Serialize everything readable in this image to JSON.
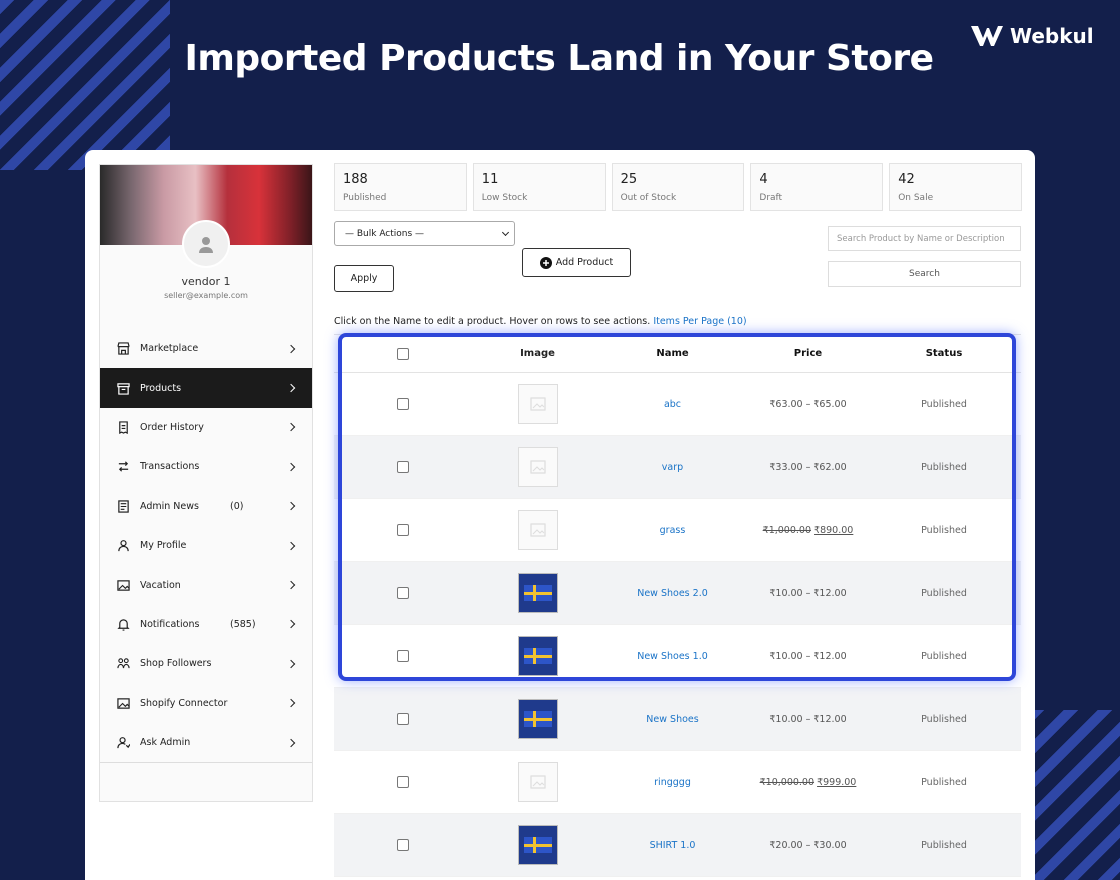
{
  "headline": "Imported Products Land in Your Store",
  "brand": {
    "name": "Webkul"
  },
  "vendor": {
    "name": "vendor 1",
    "email": "seller@example.com"
  },
  "nav": [
    {
      "label": "Marketplace",
      "icon": "store-icon",
      "count": ""
    },
    {
      "label": "Products",
      "icon": "box-icon",
      "count": "",
      "active": true
    },
    {
      "label": "Order History",
      "icon": "receipt-icon",
      "count": ""
    },
    {
      "label": "Transactions",
      "icon": "transfer-icon",
      "count": ""
    },
    {
      "label": "Admin News",
      "icon": "news-icon",
      "count": "(0)"
    },
    {
      "label": "My Profile",
      "icon": "user-icon",
      "count": ""
    },
    {
      "label": "Vacation",
      "icon": "image-icon",
      "count": ""
    },
    {
      "label": "Notifications",
      "icon": "bell-icon",
      "count": "(585)"
    },
    {
      "label": "Shop Followers",
      "icon": "followers-icon",
      "count": ""
    },
    {
      "label": "Shopify Connector",
      "icon": "image-icon",
      "count": ""
    },
    {
      "label": "Ask Admin",
      "icon": "user-question-icon",
      "count": ""
    }
  ],
  "stats": [
    {
      "value": "188",
      "label": "Published"
    },
    {
      "value": "11",
      "label": "Low Stock"
    },
    {
      "value": "25",
      "label": "Out of Stock"
    },
    {
      "value": "4",
      "label": "Draft"
    },
    {
      "value": "42",
      "label": "On Sale"
    }
  ],
  "toolbar": {
    "bulk_actions": "— Bulk Actions —",
    "apply": "Apply",
    "add_product": "Add Product",
    "search_placeholder": "Search Product by Name or Description",
    "search": "Search"
  },
  "hint": {
    "text": "Click on the Name to edit a product. Hover on rows to see actions.",
    "link": "Items Per Page (10)"
  },
  "table": {
    "headers": {
      "image": "Image",
      "name": "Name",
      "price": "Price",
      "status": "Status"
    },
    "rows": [
      {
        "name": "abc",
        "thumb": "placeholder",
        "price_old": "",
        "price": "₹63.00 – ₹65.00",
        "status": "Published"
      },
      {
        "name": "varp",
        "thumb": "placeholder",
        "price_old": "",
        "price": "₹33.00 – ₹62.00",
        "status": "Published"
      },
      {
        "name": "grass",
        "thumb": "placeholder",
        "price_old": "₹1,000.00",
        "price": "₹890.00",
        "status": "Published"
      },
      {
        "name": "New Shoes 2.0",
        "thumb": "photo",
        "price_old": "",
        "price": "₹10.00 – ₹12.00",
        "status": "Published"
      },
      {
        "name": "New Shoes 1.0",
        "thumb": "photo",
        "price_old": "",
        "price": "₹10.00 – ₹12.00",
        "status": "Published"
      },
      {
        "name": "New Shoes",
        "thumb": "photo",
        "price_old": "",
        "price": "₹10.00 – ₹12.00",
        "status": "Published"
      },
      {
        "name": "ringggg",
        "thumb": "placeholder",
        "price_old": "₹10,000.00",
        "price": "₹999.00",
        "status": "Published"
      },
      {
        "name": "SHIRT 1.0",
        "thumb": "photo",
        "price_old": "",
        "price": "₹20.00 – ₹30.00",
        "status": "Published"
      }
    ]
  },
  "colors": {
    "background": "#131f4b",
    "highlight": "#2e46d9",
    "link": "#1a73c7",
    "active_nav": "#1b1b1b"
  }
}
